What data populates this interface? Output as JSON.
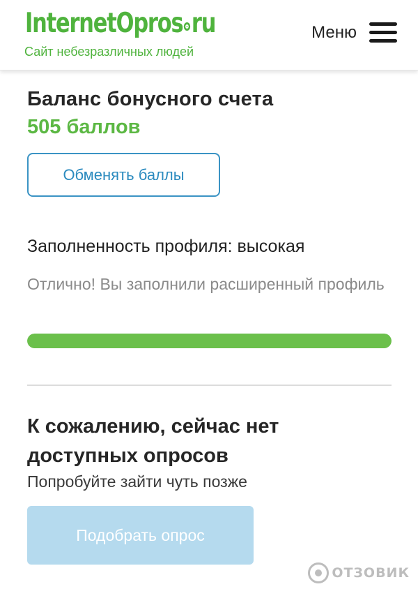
{
  "header": {
    "logo_part1": "Internet",
    "logo_part2": "Opros",
    "logo_part3": "ru",
    "tagline": "Сайт небезразличных людей",
    "menu_label": "Меню",
    "menu_icon": "hamburger-menu-icon"
  },
  "balance": {
    "title": "Баланс бонусного счета",
    "value": "505 баллов",
    "exchange_button": "Обменять баллы"
  },
  "profile": {
    "title": "Заполненность профиля: высокая",
    "description": "Отлично! Вы заполнили расширенный профиль",
    "progress_fraction": 1.0
  },
  "surveys": {
    "title": "К сожалению, сейчас нет доступных опросов",
    "subtitle": "Попробуйте зайти чуть позже",
    "pick_button": "Подобрать опрос"
  },
  "watermark": {
    "text": "ОТЗОВИК"
  },
  "colors": {
    "brand_green": "#4fb33d",
    "accent_blue": "#3a93c4",
    "progress_green": "#6bc04b",
    "disabled_button": "#b5daee"
  }
}
